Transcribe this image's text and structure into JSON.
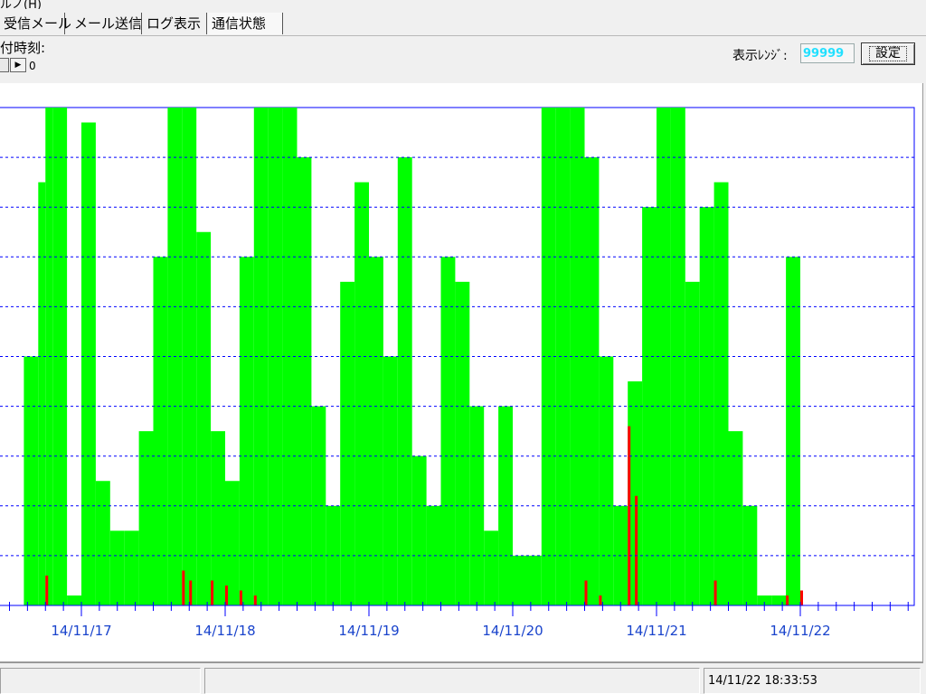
{
  "menu": {
    "partial_text": "ルノ(H)"
  },
  "tabs": [
    "受信メール",
    "メール送信",
    "ログ表示",
    "通信状態"
  ],
  "toolbar": {
    "jump_label": "付時刻:",
    "spin_value": "0",
    "range_label": "表示ﾚﾝｼﾞ:",
    "range_value": "99999",
    "set_button": "設定"
  },
  "status": {
    "timestamp": "14/11/22 18:33:53"
  },
  "colors": {
    "upload": "#00ff00",
    "download": "#ff0000",
    "axis": "#0000ff",
    "grid": "#0000ff",
    "label": "#1a44cc"
  },
  "icons": {
    "spin_right": "right-triangle-icon"
  },
  "chart_data": {
    "type": "bar",
    "x_tick_labels": [
      "14/11/17",
      "14/11/18",
      "14/11/19",
      "14/11/20",
      "14/11/21",
      "14/11/22"
    ],
    "ylim": [
      0,
      1
    ],
    "grid": true,
    "gridlines": 10,
    "legend": "none",
    "series": [
      {
        "color": "#00ff00",
        "points": [
          [
            16.6,
            0.5
          ],
          [
            16.7,
            0.85
          ],
          [
            16.75,
            1
          ],
          [
            16.8,
            1
          ],
          [
            16.9,
            0.02
          ],
          [
            17.0,
            0.97
          ],
          [
            17.1,
            0.25
          ],
          [
            17.2,
            0.15
          ],
          [
            17.3,
            0.15
          ],
          [
            17.4,
            0.35
          ],
          [
            17.5,
            0.7
          ],
          [
            17.6,
            1
          ],
          [
            17.7,
            1
          ],
          [
            17.8,
            0.75
          ],
          [
            17.9,
            0.35
          ],
          [
            18.0,
            0.25
          ],
          [
            18.1,
            0.7
          ],
          [
            18.2,
            1
          ],
          [
            18.3,
            1
          ],
          [
            18.4,
            1
          ],
          [
            18.5,
            0.9
          ],
          [
            18.6,
            0.4
          ],
          [
            18.7,
            0.2
          ],
          [
            18.8,
            0.65
          ],
          [
            18.9,
            0.85
          ],
          [
            19.0,
            0.7
          ],
          [
            19.1,
            0.5
          ],
          [
            19.2,
            0.9
          ],
          [
            19.3,
            0.3
          ],
          [
            19.4,
            0.2
          ],
          [
            19.5,
            0.7
          ],
          [
            19.6,
            0.65
          ],
          [
            19.7,
            0.4
          ],
          [
            19.8,
            0.15
          ],
          [
            19.9,
            0.4
          ],
          [
            20.0,
            0.1
          ],
          [
            20.2,
            1
          ],
          [
            20.3,
            1
          ],
          [
            20.4,
            1
          ],
          [
            20.5,
            0.9
          ],
          [
            20.6,
            0.5
          ],
          [
            20.7,
            0.2
          ],
          [
            20.8,
            0.45
          ],
          [
            20.9,
            0.8
          ],
          [
            21.0,
            1
          ],
          [
            21.1,
            1
          ],
          [
            21.2,
            0.65
          ],
          [
            21.3,
            0.8
          ],
          [
            21.4,
            0.85
          ],
          [
            21.5,
            0.35
          ],
          [
            21.6,
            0.2
          ],
          [
            21.7,
            0.02
          ],
          [
            21.8,
            0.02
          ],
          [
            21.9,
            0.7
          ]
        ]
      },
      {
        "color": "#ff0000",
        "points": [
          [
            16.75,
            0.06
          ],
          [
            17.7,
            0.07
          ],
          [
            17.75,
            0.05
          ],
          [
            17.9,
            0.05
          ],
          [
            18.0,
            0.04
          ],
          [
            18.1,
            0.03
          ],
          [
            18.2,
            0.02
          ],
          [
            20.5,
            0.05
          ],
          [
            20.6,
            0.02
          ],
          [
            20.8,
            0.36
          ],
          [
            20.85,
            0.22
          ],
          [
            21.4,
            0.05
          ],
          [
            21.9,
            0.02
          ],
          [
            22.0,
            0.03
          ]
        ]
      }
    ]
  }
}
